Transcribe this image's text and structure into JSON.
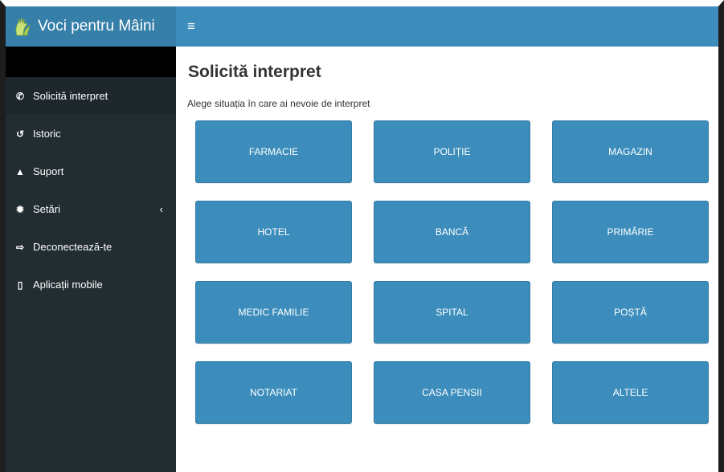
{
  "colors": {
    "header_bg": "#3c8dbc",
    "logo_bg": "#367fa9",
    "sidebar_bg": "#222d32",
    "tile_bg": "#3c8dbc"
  },
  "app": {
    "title": "Voci pentru Mâini",
    "logo_icon": "hands-icon"
  },
  "header": {
    "menu_toggle": "≡"
  },
  "sidebar": {
    "items": [
      {
        "label": "Solicită interpret",
        "icon": "phone-icon",
        "glyph": "✆",
        "active": true
      },
      {
        "label": "Istoric",
        "icon": "history-icon",
        "glyph": "↺"
      },
      {
        "label": "Suport",
        "icon": "warning-icon",
        "glyph": "▲"
      },
      {
        "label": "Setări",
        "icon": "gear-icon",
        "glyph": "✹",
        "arrow": "‹"
      },
      {
        "label": "Deconectează-te",
        "icon": "sign-out-icon",
        "glyph": "⇨"
      },
      {
        "label": "Aplicații mobile",
        "icon": "mobile-icon",
        "glyph": "▯"
      }
    ]
  },
  "main": {
    "title": "Solicită interpret",
    "subtitle": "Alege situația în care ai nevoie de interpret",
    "tiles": [
      "FARMACIE",
      "POLIȚIE",
      "MAGAZIN",
      "HOTEL",
      "BANCĂ",
      "PRIMĂRIE",
      "MEDIC FAMILIE",
      "SPITAL",
      "POȘTĂ",
      "NOTARIAT",
      "CASA PENSII",
      "ALTELE"
    ]
  }
}
